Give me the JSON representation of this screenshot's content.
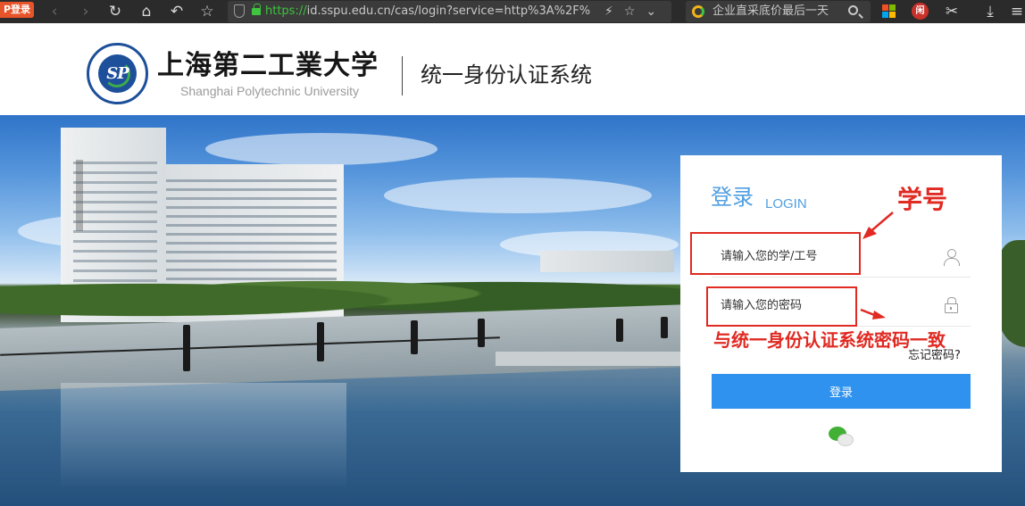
{
  "browser": {
    "tab_badge": "P登录",
    "url_scheme": "https://",
    "url_rest": "id.sspu.edu.cn/cas/login?service=http%3A%2F%",
    "search_text": "企业直采底价最后一天",
    "ext_label": "闲"
  },
  "header": {
    "school_name_cn": "上海第二工業大学",
    "school_name_en": "Shanghai Polytechnic University",
    "system_title": "统一身份认证系统"
  },
  "login": {
    "title": "登录",
    "subtitle": "LOGIN",
    "username_placeholder": "请输入您的学/工号",
    "password_placeholder": "请输入您的密码",
    "forgot_label": "忘记密码?",
    "submit_label": "登录"
  },
  "annotations": {
    "username_note": "学号",
    "password_note": "与统一身份认证系统密码一致"
  },
  "colors": {
    "accent": "#2e92ee",
    "title_blue": "#4f9ee0",
    "annotation_red": "#e02a22"
  },
  "icons": [
    "back-icon",
    "forward-icon",
    "reload-icon",
    "home-icon",
    "undo-icon",
    "star-icon",
    "shield-icon",
    "lock-icon",
    "user-icon",
    "password-lock-icon",
    "wechat-icon"
  ]
}
